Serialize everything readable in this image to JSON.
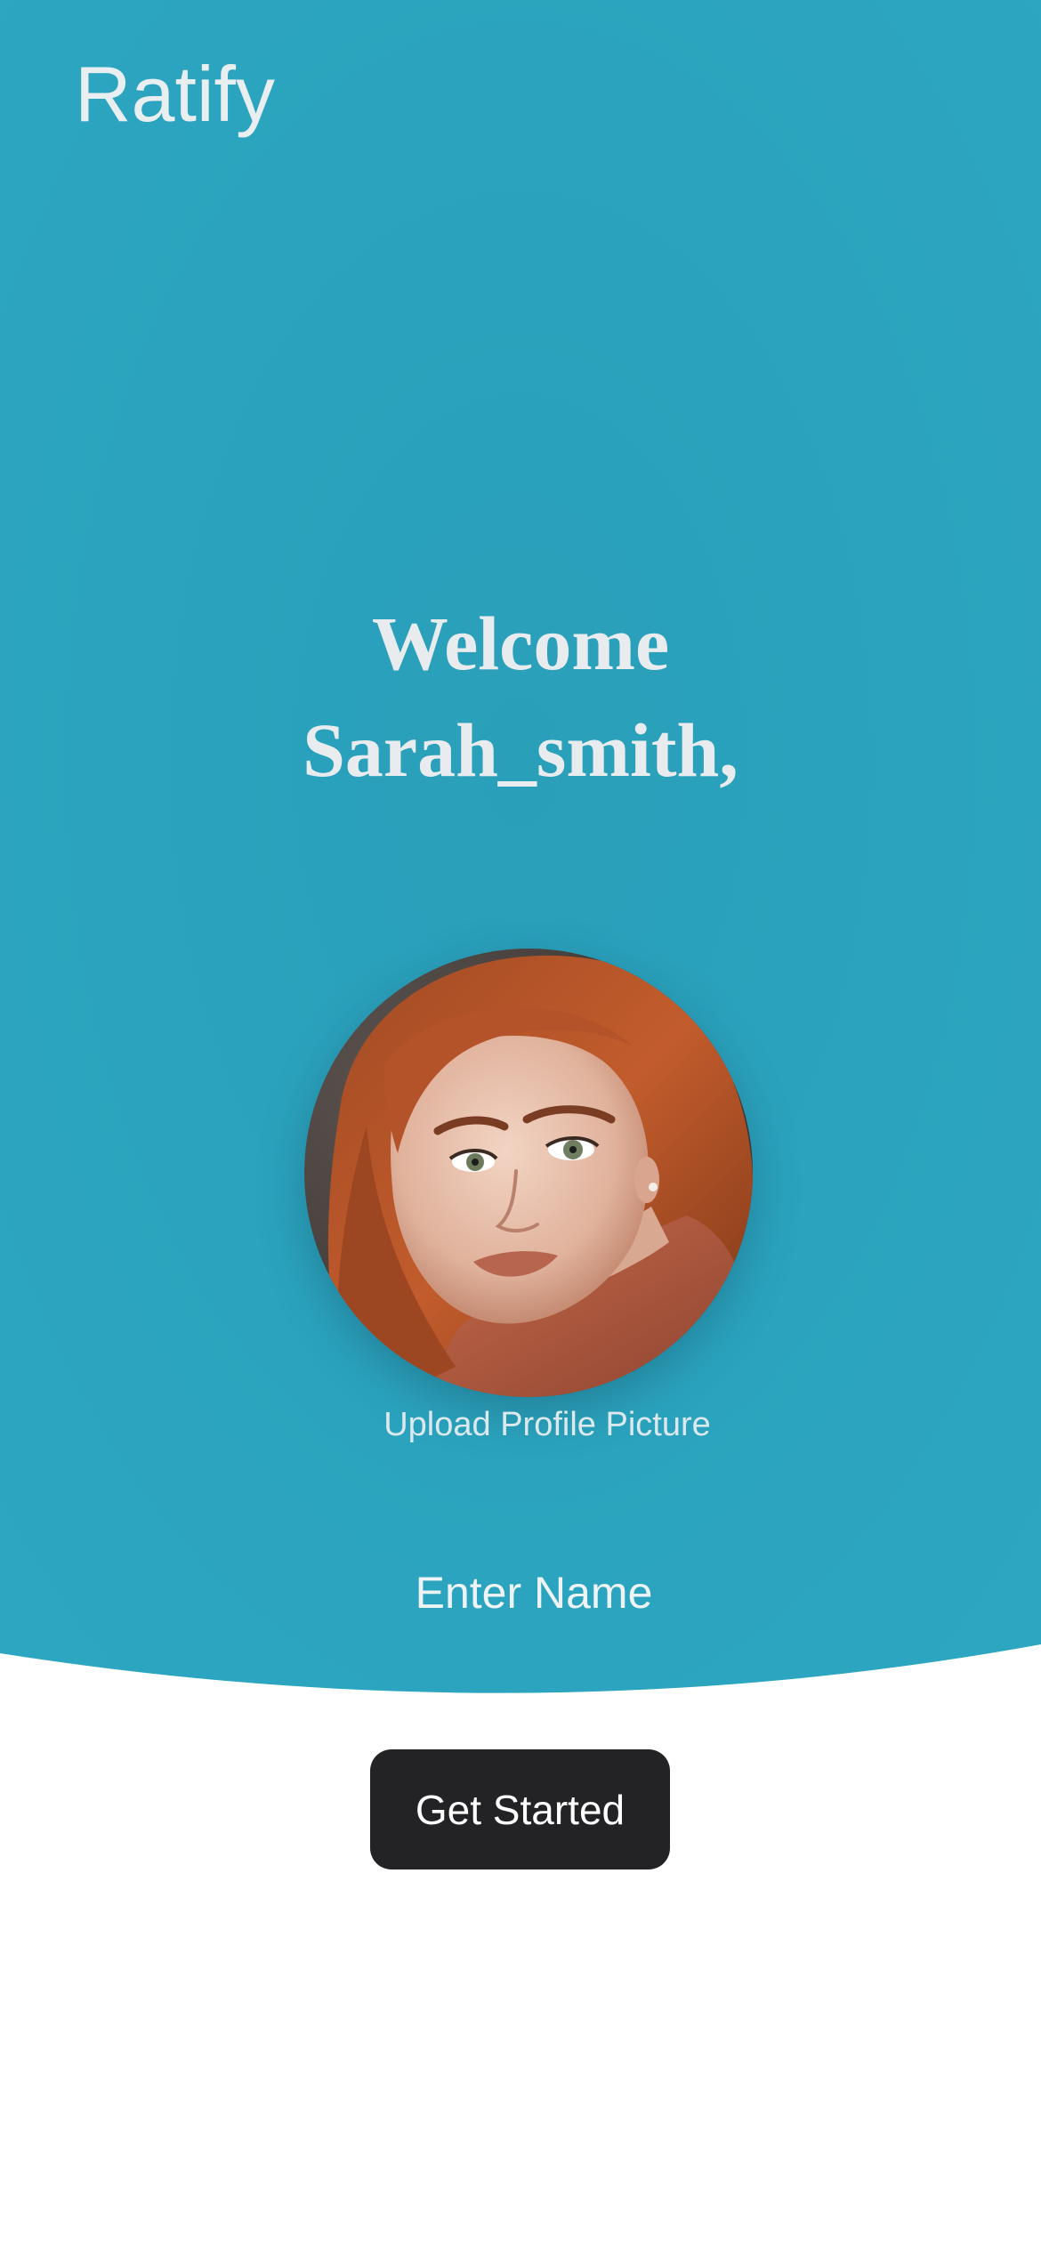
{
  "app": {
    "title": "Ratify"
  },
  "welcome": {
    "greeting": "Welcome",
    "username": "Sarah_smith,"
  },
  "profile": {
    "avatar_alt": "Profile picture",
    "upload_label": "Upload Profile Picture"
  },
  "form": {
    "name_placeholder": "Enter Name",
    "name_value": ""
  },
  "actions": {
    "get_started_label": "Get Started"
  },
  "colors": {
    "hero_background": "#2ca5c0",
    "page_background": "#ffffff",
    "button_background": "#232326",
    "button_text": "#ffffff",
    "text_light": "#e9eef0"
  }
}
